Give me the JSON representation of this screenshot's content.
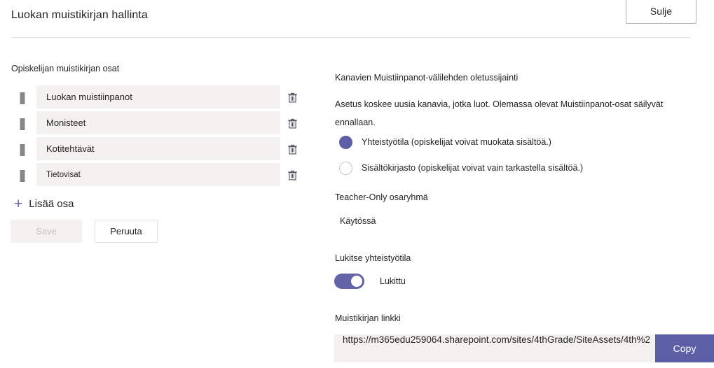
{
  "header": {
    "title": "Luokan muistikirjan hallinta",
    "close_label": "Sulje"
  },
  "left": {
    "sections_label": "Opiskelijan muistikirjan osat",
    "sections": [
      {
        "name": "Luokan muistiinpanot"
      },
      {
        "name": "Monisteet"
      },
      {
        "name": "Kotitehtävät"
      },
      {
        "name": "Tietovisat"
      }
    ],
    "add_section_label": "Lisää osa",
    "add_section_plus": "+",
    "save_label": "Save",
    "cancel_label": "Peruuta"
  },
  "right": {
    "default_location_heading": "Kanavien Muistiinpanot-välilehden oletussijainti",
    "default_location_description": "Asetus koskee uusia kanavia, jotka luot. Olemassa olevat Muistiinpanot-osat säilyvät ennallaan.",
    "radio_options": [
      {
        "label": "Yhteistyötila (opiskelijat voivat muokata sisältöä.)",
        "selected": true
      },
      {
        "label": "Sisältökirjasto (opiskelijat voivat vain tarkastella sisältöä.)",
        "selected": false
      }
    ],
    "teacher_only_heading": "Teacher-Only osaryhmä",
    "teacher_only_value": "Käytössä",
    "lock_heading": "Lukitse yhteistyötila",
    "lock_toggle_label": "Lukittu",
    "link_heading": "Muistikirjan linkki",
    "link_value": "https://m365edu259064.sharepoint.com/sites/4thGrade/SiteAssets/4th%2",
    "copy_label": "Copy"
  },
  "colors": {
    "accent_purple": "#6264a7",
    "button_purple": "#5c5fa6",
    "field_gray": "#f3f2f1",
    "divider_gray": "#e1dfdd",
    "text_primary": "#252423"
  }
}
